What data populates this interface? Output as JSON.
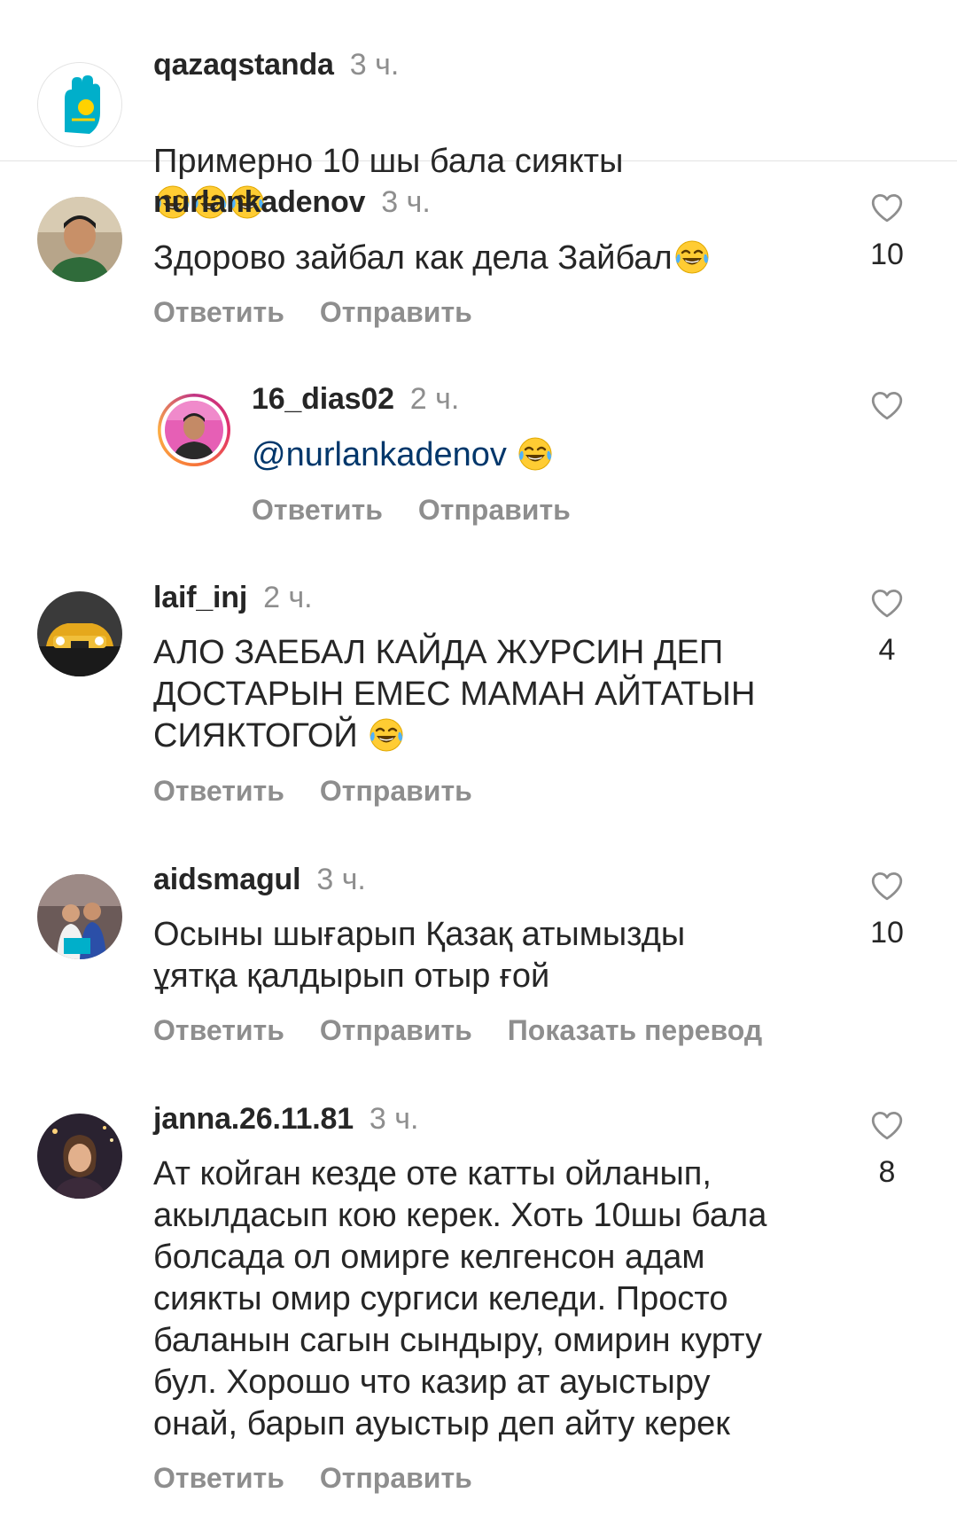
{
  "caption": {
    "username": "qazaqstanda",
    "time": "3 ч.",
    "text": "Примерно 10 шы бала сиякты",
    "emoji": "face-with-tears-of-joy-icon x3"
  },
  "actions": {
    "reply": "Ответить",
    "send": "Отправить",
    "translate": "Показать перевод"
  },
  "comments": [
    {
      "username": "nurlankadenov",
      "time": "3 ч.",
      "text": "Здорово зайбал как дела Зайбал",
      "likes": "10"
    },
    {
      "username": "16_dias02",
      "time": "2 ч.",
      "mention": "@nurlankadenov",
      "likes": ""
    },
    {
      "username": "laif_inj",
      "time": "2 ч.",
      "text": "АЛО ЗАЕБАЛ КАЙДА ЖУРСИН ДЕП\nДОСТАРЫН ЕМЕС МАМАН АЙТАТЫН\nСИЯКТОГОЙ",
      "likes": "4"
    },
    {
      "username": "aidsmagul",
      "time": "3 ч.",
      "text": "Осыны шығарып Қазақ атымызды\nұятқа қалдырып отыр ғой",
      "likes": "10"
    },
    {
      "username": "janna.26.11.81",
      "time": "3 ч.",
      "text": "Ат койган кезде оте катты ойланып,\nакылдасып кою керек. Хоть 10шы бала\nболсада ол омирге келгенсон адам\nсиякты омир сургиси келеди. Просто\nбаланын сагын сындыру, омирин курту\nбул. Хорошо что казир ат ауыстыру\nонай, барып ауыстыр деп айту керек",
      "likes": "8"
    }
  ],
  "colors": {
    "text": "#262626",
    "secondary": "#8e8e8e",
    "mention": "#00376b",
    "divider": "#e3e3e3"
  }
}
